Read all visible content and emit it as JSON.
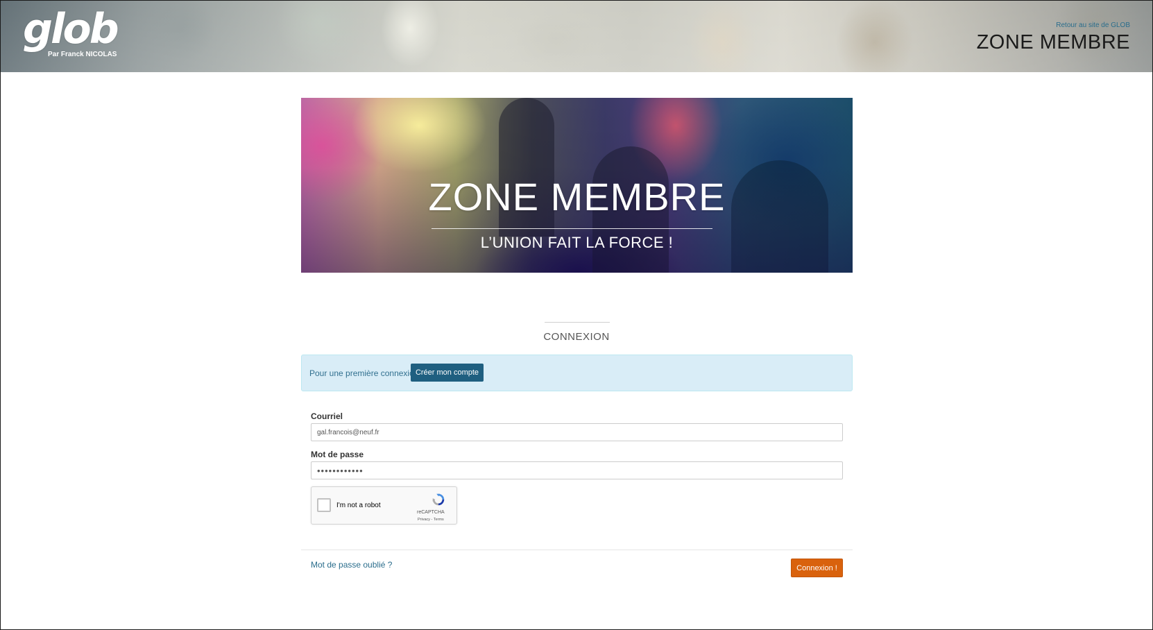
{
  "header": {
    "logo_main": "glob",
    "logo_sub": "Par Franck NICOLAS",
    "back_link": "Retour au site de GLOB",
    "title": "ZONE MEMBRE"
  },
  "banner": {
    "title": "ZONE MEMBRE",
    "subtitle": "L’UNION FAIT LA FORCE !"
  },
  "login": {
    "heading": "CONNEXION",
    "first_login_text": "Pour une première connexion",
    "create_account_label": "Créer mon compte",
    "email_label": "Courriel",
    "email_value": "gal.francois@neuf.fr",
    "password_label": "Mot de passe",
    "password_value": "••••••••••••",
    "captcha": {
      "label": "I'm not a robot",
      "brand": "reCAPTCHA",
      "links": "Privacy - Terms"
    },
    "forgot_password": "Mot de passe oublié ?",
    "submit_label": "Connexion !"
  },
  "colors": {
    "accent_blue": "#1f5f80",
    "submit_orange": "#d9620d",
    "alert_bg": "#d9edf7",
    "link": "#2a6d8c"
  }
}
